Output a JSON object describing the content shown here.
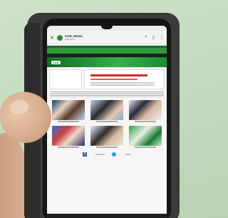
{
  "browser": {
    "page_title": "CAD. Home",
    "page_url": "cad.sc.in",
    "close_glyph": "✕",
    "icons": [
      "share-icon",
      "bookmark-icon",
      "menu-dots-icon"
    ]
  },
  "site": {
    "logo_text": "CAD",
    "social": [
      {
        "name": "facebook-icon",
        "label": "Facebook"
      },
      {
        "name": "twitter-icon",
        "label": "Twitter"
      }
    ]
  },
  "colors": {
    "site_green": "#2f9a40",
    "dark_green": "#1d6b2a",
    "case": "#3a3a38",
    "background": "#c3dcbf"
  }
}
